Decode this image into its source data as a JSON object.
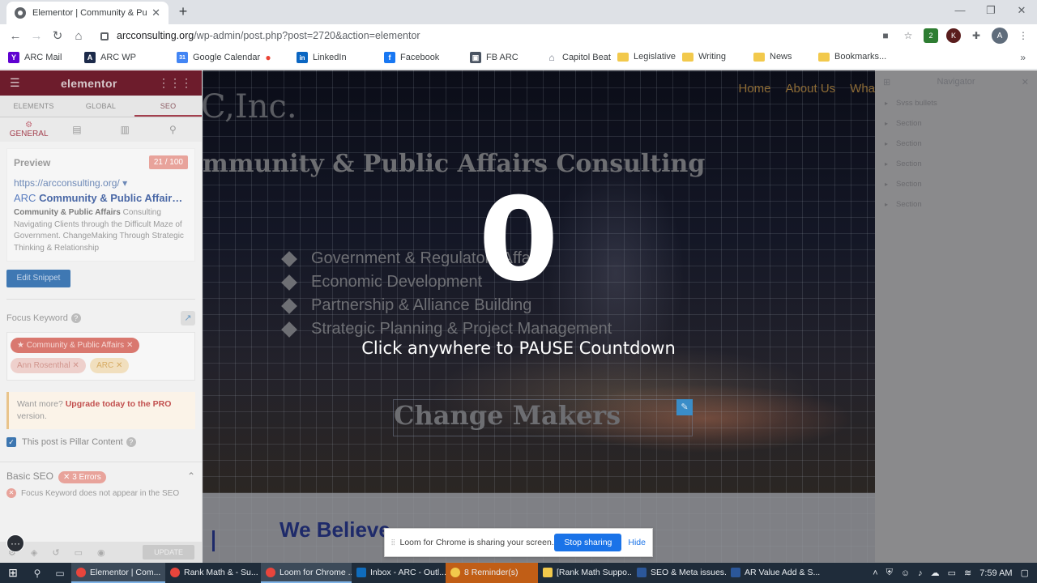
{
  "browser": {
    "tab_title": "Elementor | Community & Public Affairs",
    "tab_close": "✕",
    "new_tab": "+",
    "url_host": "arcconsulting.org",
    "url_path": "/wp-admin/post.php?post=2720&action=elementor",
    "avatar_letter": "A",
    "ext_letter": "K",
    "ext_count": "2"
  },
  "bookmarks": [
    {
      "label": "ARC Mail",
      "icon": "yahoo-icon",
      "color": "#5f01d1",
      "glyph": "Y"
    },
    {
      "label": "ARC WP",
      "icon": "arc-logo-icon",
      "color": "#1c2a4a",
      "glyph": "A"
    },
    {
      "label": "Google Calendar",
      "icon": "calendar-icon",
      "color": "#4285f4",
      "glyph": "31"
    },
    {
      "label": "",
      "icon": "maps-pin-icon",
      "color": "#34a853",
      "glyph": "●"
    },
    {
      "label": "LinkedIn",
      "icon": "linkedin-icon",
      "color": "#0a66c2",
      "glyph": "in"
    },
    {
      "label": "Facebook",
      "icon": "facebook-icon",
      "color": "#1877f2",
      "glyph": "f"
    },
    {
      "label": "FB ARC",
      "icon": "fb-arc-icon",
      "color": "#4b5563",
      "glyph": "▣"
    },
    {
      "label": "Capitol Beat",
      "icon": "capitol-icon",
      "color": "#6b7280",
      "glyph": "⌂"
    },
    {
      "label": "Legislative",
      "icon": "folder-icon",
      "color": "#f2c94c",
      "glyph": ""
    },
    {
      "label": "Writing",
      "icon": "folder-icon",
      "color": "#f2c94c",
      "glyph": ""
    },
    {
      "label": "News",
      "icon": "folder-icon",
      "color": "#f2c94c",
      "glyph": ""
    },
    {
      "label": "Bookmarks...",
      "icon": "folder-icon",
      "color": "#f2c94c",
      "glyph": ""
    }
  ],
  "elementor": {
    "logo": "elementor",
    "tabs": [
      "ELEMENTS",
      "GLOBAL",
      "SEO"
    ],
    "active_tab": "SEO",
    "subtab_general": "GENERAL",
    "preview_label": "Preview",
    "score": "21 / 100",
    "preview_url": "https://arcconsulting.org/",
    "preview_caret": "▾",
    "preview_title_prefix": "ARC",
    "preview_title_bold": "Community & Public Affair…",
    "preview_desc_bold": "Community & Public Affairs",
    "preview_desc_rest": "Consulting Navigating Clients through the Difficult Maze of Government. ChangeMaking Through Strategic Thinking & Relationship",
    "edit_snippet": "Edit Snippet",
    "focus_keyword_label": "Focus Keyword",
    "keywords": [
      "Community & Public Affairs",
      "Ann Rosenthal",
      "ARC"
    ],
    "kw_star": "★",
    "kw_remove": "✕",
    "pro_prefix": "Want more?",
    "pro_link": "Upgrade today to the PRO",
    "pro_suffix": "version.",
    "pillar_label": "This post is Pillar Content",
    "basic_seo_label": "Basic SEO",
    "errors_badge": "✕ 3 Errors",
    "seo_item": "Focus Keyword does not appear in the SEO",
    "update_btn": "UPDATE"
  },
  "site": {
    "brand": "C,Inc.",
    "nav": [
      "Home",
      "About Us",
      "Wha"
    ],
    "headline": "mmunity & Public Affairs Consulting",
    "bullets": [
      "Government & Regulatory Affairs",
      "Economic Development",
      "Partnership & Alliance Building",
      "Strategic Planning & Project Management"
    ],
    "change_makers": "Change Makers",
    "we_believe": "We Believe"
  },
  "countdown": {
    "number": "0",
    "message": "Click anywhere to PAUSE Countdown"
  },
  "navigator": {
    "title": "Navigator",
    "items": [
      "Svss bullets",
      "Section",
      "Section",
      "Section",
      "Section",
      "Section"
    ]
  },
  "loom": {
    "message": "Loom for Chrome is sharing your screen.",
    "stop": "Stop sharing",
    "hide": "Hide",
    "bubble": "···"
  },
  "taskbar": {
    "items": [
      {
        "label": "Elementor | Com...",
        "icon": "chrome-icon",
        "color": "#e8453c",
        "style": "active"
      },
      {
        "label": "Rank Math & - Su...",
        "icon": "chrome-icon",
        "color": "#e8453c",
        "style": ""
      },
      {
        "label": "Loom for Chrome ...",
        "icon": "chrome-icon",
        "color": "#e8453c",
        "style": "active"
      },
      {
        "label": "Inbox - ARC - Outl...",
        "icon": "outlook-icon",
        "color": "#0f6cbd",
        "style": ""
      },
      {
        "label": "8 Reminder(s)",
        "icon": "bell-icon",
        "color": "#f2c94c",
        "style": "warn"
      },
      {
        "label": "[Rank Math Suppo...",
        "icon": "mail-icon",
        "color": "#f2c94c",
        "style": ""
      },
      {
        "label": "SEO & Meta issues...",
        "icon": "word-icon",
        "color": "#2b579a",
        "style": ""
      },
      {
        "label": "AR Value Add & S...",
        "icon": "word-icon",
        "color": "#2b579a",
        "style": ""
      }
    ],
    "time": "7:59 AM"
  }
}
